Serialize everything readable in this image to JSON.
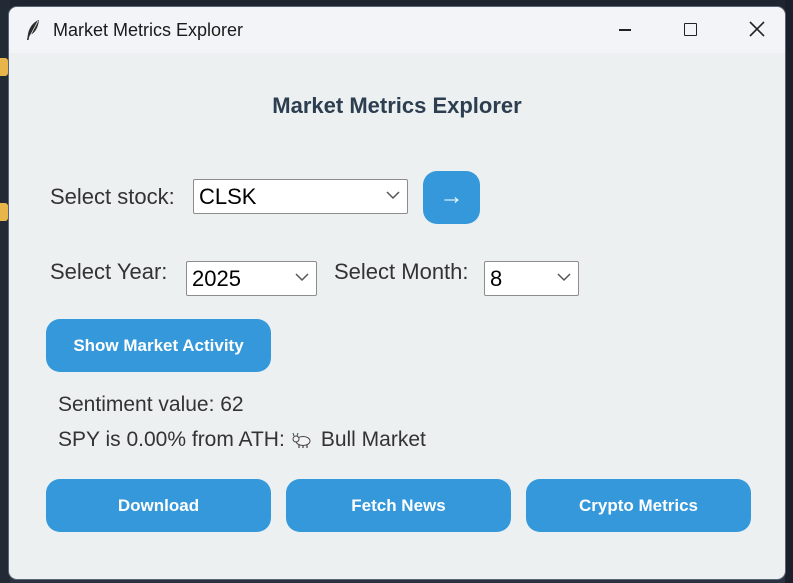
{
  "window": {
    "title": "Market Metrics Explorer"
  },
  "heading": "Market Metrics Explorer",
  "stock": {
    "label": "Select stock:",
    "selected": "CLSK",
    "go_button": "→"
  },
  "year": {
    "label": "Select Year:",
    "selected": "2025"
  },
  "month": {
    "label": "Select Month:",
    "selected": "8"
  },
  "buttons": {
    "show_activity": "Show Market Activity",
    "download": "Download",
    "fetch_news": "Fetch News",
    "crypto_metrics": "Crypto Metrics"
  },
  "sentiment_text": "Sentiment value: 62",
  "spy": {
    "text": "SPY is 0.00% from ATH:",
    "market_icon": "bull-icon",
    "market_status": "Bull Market"
  },
  "colors": {
    "accent": "#3498db",
    "heading": "#2c3e50",
    "window_bg": "#ecf0f1"
  }
}
